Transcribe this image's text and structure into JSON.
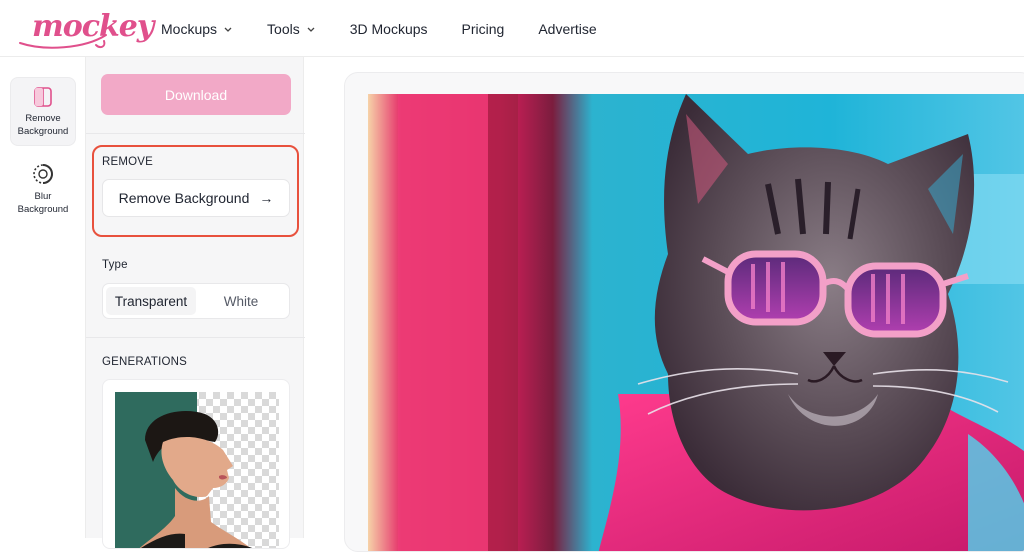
{
  "brand": {
    "logo_text": "mockey",
    "accent": "#e0508c"
  },
  "nav": {
    "items": [
      {
        "label": "Mockups",
        "has_dropdown": true
      },
      {
        "label": "Tools",
        "has_dropdown": true
      },
      {
        "label": "3D Mockups",
        "has_dropdown": false
      },
      {
        "label": "Pricing",
        "has_dropdown": false
      },
      {
        "label": "Advertise",
        "has_dropdown": false
      }
    ]
  },
  "rail": {
    "tools": [
      {
        "label_line1": "Remove",
        "label_line2": "Background",
        "icon": "split-square-icon",
        "active": true
      },
      {
        "label_line1": "Blur",
        "label_line2": "Background",
        "icon": "blur-circle-icon",
        "active": false
      }
    ]
  },
  "panel": {
    "download_label": "Download",
    "download_color": "#f2a9c7",
    "remove_section": {
      "heading": "REMOVE",
      "button_label": "Remove Background",
      "arrow": "→",
      "highlight_color": "#e8513d"
    },
    "type_section": {
      "heading": "Type",
      "options": [
        "Transparent",
        "White"
      ],
      "selected": "Transparent"
    },
    "generations_heading": "GENERATIONS"
  },
  "canvas": {
    "image_subject": "cat-with-pink-sunglasses"
  }
}
